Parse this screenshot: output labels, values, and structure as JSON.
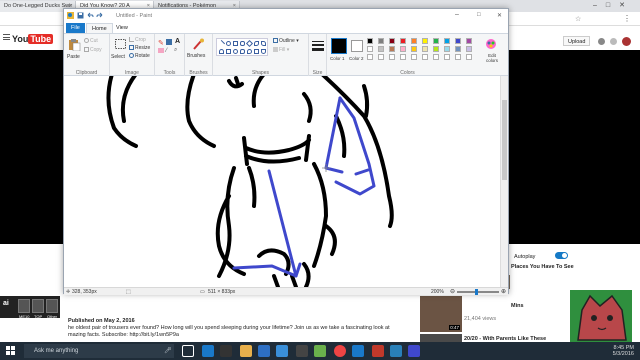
{
  "browser": {
    "tabs": [
      {
        "label": "Do One-Legged Ducks Swir"
      },
      {
        "label": "Did You Know? 20 A"
      },
      {
        "label": "Notifications - Pokémon"
      }
    ]
  },
  "youtube": {
    "logo": "You",
    "logo_tube": "Tube",
    "upload_label": "Upload",
    "autoplay_label": "Autoplay",
    "up_next": "Places You Have To See",
    "sidebar_items": [
      {
        "title": "Mins",
        "meta": ""
      },
      {
        "title": "",
        "meta": "21,404 views"
      },
      {
        "title": "20/20 - With Parents Like These",
        "meta": ""
      }
    ],
    "thumb_time": "0:47",
    "published": "Published on May 2, 2016",
    "description_1": "he oldest pair of trousers ever found? How long will you spend sleeping during your lifetime? Join us as we take a fascinating look at",
    "description_2": "mazing facts. Subscribe: http://bit.ly/1wn5P9a",
    "channel_label": "ai",
    "channel_buttons": [
      "ME10",
      "TOP",
      "Other"
    ]
  },
  "paint": {
    "title": "Untitled - Paint",
    "tabs": {
      "file": "File",
      "home": "Home",
      "view": "View"
    },
    "clipboard": {
      "paste": "Paste",
      "cut": "Cut",
      "copy": "Copy",
      "label": "Clipboard"
    },
    "image": {
      "select": "Select",
      "crop": "Crop",
      "resize": "Resize",
      "rotate": "Rotate",
      "label": "Image"
    },
    "tools": {
      "label": "Tools"
    },
    "brushes": {
      "label": "Brushes"
    },
    "shapes": {
      "outline": "Outline",
      "fill": "Fill",
      "label": "Shapes"
    },
    "size": {
      "label": "Size"
    },
    "colors": {
      "color1": "Color 1",
      "color2": "Color 2",
      "edit": "Edit colors",
      "label": "Colors"
    },
    "status": {
      "cursor": "328, 353px",
      "selection": "",
      "dimensions": "511 × 833px",
      "zoom": "200%"
    },
    "palette": [
      "#000000",
      "#7f7f7f",
      "#880015",
      "#ed1c24",
      "#ff7f27",
      "#fff200",
      "#22b14c",
      "#00a2e8",
      "#3f48cc",
      "#a349a4",
      "#ffffff",
      "#c3c3c3",
      "#b97a57",
      "#ffaec9",
      "#ffc90e",
      "#efe4b0",
      "#b5e61d",
      "#99d9ea",
      "#7092be",
      "#c8bfe7",
      "#ffffff",
      "#ffffff",
      "#ffffff",
      "#ffffff",
      "#ffffff",
      "#ffffff",
      "#ffffff",
      "#ffffff",
      "#ffffff",
      "#ffffff"
    ],
    "color1": "#000000",
    "color2": "#ffffff",
    "accent": "#1979ca",
    "stroke_blue": "#3f48cc"
  },
  "taskbar": {
    "search_placeholder": "Ask me anything",
    "time": "8:45 PM",
    "date": "5/3/2016"
  }
}
